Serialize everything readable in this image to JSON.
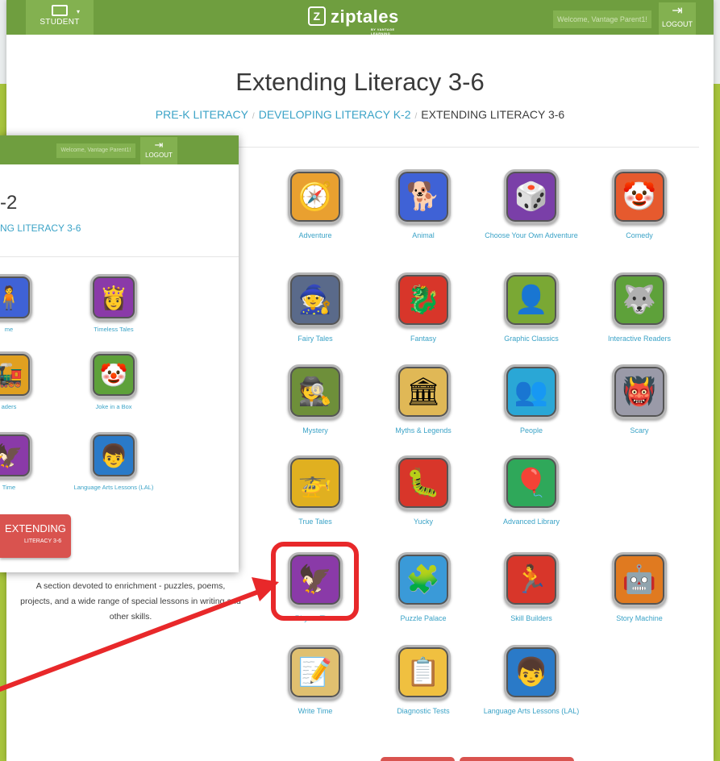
{
  "topbar": {
    "student_label": "STUDENT",
    "logo_text": "ziptales",
    "logo_sub": "BY VANTAGE LEARNING",
    "welcome": "Welcome, Vantage Parent1!",
    "logout_label": "LOGOUT"
  },
  "page": {
    "title": "Extending Literacy 3-6",
    "breadcrumb": [
      "PRE-K LITERACY",
      "DEVELOPING LITERACY K-2",
      "EXTENDING LITERACY 3-6"
    ]
  },
  "tiles": [
    {
      "label": "Adventure",
      "icon": "adventure-icon",
      "glyph": "🧭",
      "bg": "#e9a030"
    },
    {
      "label": "Animal",
      "icon": "animal-icon",
      "glyph": "🐕",
      "bg": "#3f62d6"
    },
    {
      "label": "Choose Your Own Adventure",
      "icon": "choose-adventure-icon",
      "glyph": "🎲",
      "bg": "#7a3fa8"
    },
    {
      "label": "Comedy",
      "icon": "comedy-icon",
      "glyph": "🤡",
      "bg": "#e65a2e"
    },
    {
      "label": "Fairy Tales",
      "icon": "fairy-tales-icon",
      "glyph": "🧙",
      "bg": "#5a6a8a"
    },
    {
      "label": "Fantasy",
      "icon": "fantasy-icon",
      "glyph": "🐉",
      "bg": "#d8362a"
    },
    {
      "label": "Graphic Classics",
      "icon": "graphic-classics-icon",
      "glyph": "👤",
      "bg": "#7aa834"
    },
    {
      "label": "Interactive Readers",
      "icon": "interactive-readers-icon",
      "glyph": "🐺",
      "bg": "#5ea13a"
    },
    {
      "label": "Mystery",
      "icon": "mystery-icon",
      "glyph": "🕵",
      "bg": "#6e8f3a"
    },
    {
      "label": "Myths & Legends",
      "icon": "myths-legends-icon",
      "glyph": "🏛",
      "bg": "#e0b856"
    },
    {
      "label": "People",
      "icon": "people-icon",
      "glyph": "👥",
      "bg": "#2aa7d6"
    },
    {
      "label": "Scary",
      "icon": "scary-icon",
      "glyph": "👹",
      "bg": "#9a9aa8"
    },
    {
      "label": "True Tales",
      "icon": "true-tales-icon",
      "glyph": "🚁",
      "bg": "#e0b020"
    },
    {
      "label": "Yucky",
      "icon": "yucky-icon",
      "glyph": "🐛",
      "bg": "#d8362a"
    },
    {
      "label": "Advanced Library",
      "icon": "advanced-library-icon",
      "glyph": "🎈",
      "bg": "#2fa85a"
    },
    {
      "label": "Rhyme Time",
      "icon": "rhyme-time-icon",
      "glyph": "🦅",
      "bg": "#8a3aa8"
    },
    {
      "label": "Puzzle Palace",
      "icon": "puzzle-palace-icon",
      "glyph": "🧩",
      "bg": "#3a9ad8"
    },
    {
      "label": "Skill Builders",
      "icon": "skill-builders-icon",
      "glyph": "🏃",
      "bg": "#d8362a"
    },
    {
      "label": "Story Machine",
      "icon": "story-machine-icon",
      "glyph": "🤖",
      "bg": "#e07a20"
    },
    {
      "label": "Write Time",
      "icon": "write-time-icon",
      "glyph": "📝",
      "bg": "#e0c070"
    },
    {
      "label": "Diagnostic Tests",
      "icon": "diagnostic-tests-icon",
      "glyph": "📋",
      "bg": "#f0c040"
    },
    {
      "label": "Language Arts Lessons (LAL)",
      "icon": "language-arts-icon",
      "glyph": "👦",
      "bg": "#2a7ac8"
    }
  ],
  "overlay": {
    "welcome": "Welcome, Vantage Parent1!",
    "logout_label": "LOGOUT",
    "title": "-2",
    "crumb": "NG LITERACY 3-6",
    "tiles": [
      {
        "label": "me",
        "icon": "partial-tile-icon",
        "glyph": "🧍",
        "bg": "#3f62d6"
      },
      {
        "label": "Timeless Tales",
        "icon": "timeless-tales-icon",
        "glyph": "👸",
        "bg": "#8a3aa8"
      },
      {
        "label": "aders",
        "icon": "partial-tile-icon",
        "glyph": "🚂",
        "bg": "#e0a020"
      },
      {
        "label": "Joke in a Box",
        "icon": "joke-in-a-box-icon",
        "glyph": "🤡",
        "bg": "#5ea13a"
      },
      {
        "label": "Time",
        "icon": "partial-tile-icon",
        "glyph": "🦅",
        "bg": "#8a3aa8"
      },
      {
        "label": "Language Arts Lessons (LAL)",
        "icon": "language-arts-icon",
        "glyph": "👦",
        "bg": "#2a7ac8"
      }
    ],
    "button_big": "EXTENDING",
    "button_small": "LITERACY 3-6"
  },
  "description": "A section devoted to enrichment - puzzles, poems, projects, and a wide range of special lessons in writing and other skills."
}
